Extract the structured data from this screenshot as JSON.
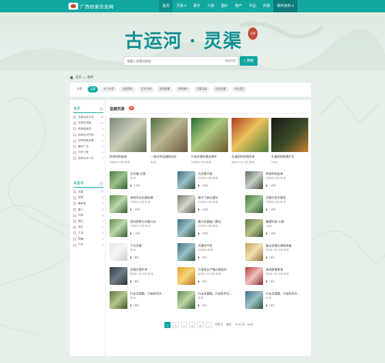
{
  "brand": {
    "logo_text": "广西档案信息网"
  },
  "nav": [
    {
      "label": "首页"
    },
    {
      "label": "灵渠 ▾"
    },
    {
      "label": "事件"
    },
    {
      "label": "人物"
    },
    {
      "label": "图片"
    },
    {
      "label": "物产"
    },
    {
      "label": "作品"
    },
    {
      "label": "风貌"
    },
    {
      "label": "视听资料 ▾"
    }
  ],
  "hero": {
    "title": "古运河 · 灵渠",
    "seal": "灵渠"
  },
  "search": {
    "placeholder": "请输入关键词搜索",
    "advanced": "高级检索",
    "button": "搜索"
  },
  "breadcrumb": {
    "home": "首页",
    "sep": ">",
    "current": "视听"
  },
  "filters": [
    {
      "label": "分类",
      "style": "plain"
    },
    {
      "label": "全部",
      "style": "active"
    },
    {
      "label": "名人名家",
      "style": ""
    },
    {
      "label": "古建遗存",
      "style": ""
    },
    {
      "label": "文学书画",
      "style": ""
    },
    {
      "label": "民间故事",
      "style": ""
    },
    {
      "label": "特色物产",
      "style": ""
    },
    {
      "label": "灵渠风貌",
      "style": ""
    },
    {
      "label": "民俗风情",
      "style": ""
    },
    {
      "label": "兴安县区",
      "style": ""
    }
  ],
  "sidebar": {
    "group1": {
      "title": "来源",
      "items": [
        {
          "label": "灵渠历史文化",
          "count": "15"
        },
        {
          "label": "灵渠史话篇",
          "count": "10"
        },
        {
          "label": "桂林档案馆",
          "count": "5"
        },
        {
          "label": "桂林山水传说",
          "count": "4"
        },
        {
          "label": "桂林档案文献",
          "count": "2"
        },
        {
          "label": "廉州广西",
          "count": "2"
        },
        {
          "label": "百年八桂",
          "count": "1"
        },
        {
          "label": "桂林山水人文",
          "count": "1"
        }
      ]
    },
    "group2": {
      "title": "关键词",
      "items": [
        {
          "label": "灵渠",
          "count": "22"
        },
        {
          "label": "桂林",
          "count": "6"
        },
        {
          "label": "秦始皇",
          "count": "6"
        },
        {
          "label": "陡门",
          "count": "6"
        },
        {
          "label": "兴安",
          "count": "5"
        },
        {
          "label": "湘江",
          "count": "5"
        },
        {
          "label": "漓江",
          "count": "4"
        },
        {
          "label": "大湾",
          "count": "4"
        },
        {
          "label": "铧嘴",
          "count": "3"
        },
        {
          "label": "严关",
          "count": "3"
        }
      ]
    }
  },
  "list": {
    "title": "音频列表",
    "count": "16"
  },
  "big_cards": [
    {
      "title": "四贤祠的由来",
      "sub": "华夏航标·灵渠·第5集",
      "tone": "g1"
    },
    {
      "title": "一座古桥连通的历史",
      "sub": "第1集",
      "tone": "g2"
    },
    {
      "title": "兴安灵渠申遗五周年",
      "sub": "华夏航标·灵渠·第2集",
      "tone": "g3"
    },
    {
      "title": "孔雀园的秀丽风采",
      "sub": "梁跃进·兴安·灵渠·第4集",
      "tone": "g4"
    },
    {
      "title": "孔雀园的夜景灯光",
      "sub": "华夏灵",
      "tone": "g5"
    }
  ],
  "cards": [
    {
      "title": "分水塘·七跳",
      "sub": "第2集",
      "meta": "20播放",
      "tone": "g6"
    },
    {
      "title": "古灵渠河道",
      "sub": "华夏航标·灵渠·第9集",
      "meta": "20播放",
      "tone": "g7"
    },
    {
      "title": "四贤祠的由来",
      "sub": "华夏航标·灵渠·第3集",
      "meta": "16播放",
      "tone": "g8"
    },
    {
      "title": "李明华在灵渠修建",
      "sub": "华夏航标·灵渠·第1集",
      "meta": "15播放",
      "tone": "g9"
    },
    {
      "title": "秦代飞来石遗址",
      "sub": "华夏航标·灵渠·第4集",
      "meta": "14播放",
      "tone": "g10"
    },
    {
      "title": "灵渠大型灵渠泉",
      "sub": "华夏航标·灵渠·第7集",
      "meta": "13播放",
      "tone": "g6"
    },
    {
      "title": "西村桥畔与灵渠分水",
      "sub": "华夏航标·灵渠·第3集",
      "meta": "12播放",
      "tone": "g9"
    },
    {
      "title": "秦开灵渠陡门遗址",
      "sub": "华夏航标·灵渠·第6集",
      "meta": "11播放",
      "tone": "g7"
    },
    {
      "title": "秦堤四贤·七跳",
      "sub": "大秦岭",
      "meta": "10播放",
      "tone": "g16"
    },
    {
      "title": "千古灵渠",
      "sub": "第1集",
      "meta": "9播放",
      "tone": "g11"
    },
    {
      "title": "灵渠的今世",
      "sub": "华夏航标·第5集",
      "meta": "9播放",
      "tone": "g7"
    },
    {
      "title": "陡元灵渠古建筑修复",
      "sub": "梁跃进·兴安·灵渠·第2集",
      "meta": "8播放",
      "tone": "g12"
    },
    {
      "title": "灵渠大营严关",
      "sub": "梁跃进·兴安·灵渠·第1集",
      "meta": "8播放",
      "tone": "g13"
    },
    {
      "title": "万里桥头严镇与黄旭华",
      "sub": "梁跃进·兴安·灵渠·第3集",
      "meta": "7播放",
      "tone": "g14"
    },
    {
      "title": "海滨泉雾景观",
      "sub": "梁跃进·兴安·灵渠·第4集",
      "meta": "7播放",
      "tone": "g15"
    },
    {
      "title": "行走灵渠篇，兴安彩色天…",
      "sub": "第2集",
      "meta": "6播放",
      "tone": "g16"
    },
    {
      "title": "行走灵渠篇，兴安彩色天…",
      "sub": "第3集",
      "meta": "6播放",
      "tone": "g9"
    },
    {
      "title": "行走灵渠篇，兴安彩色天…",
      "sub": "第1集",
      "meta": "5播放",
      "tone": "g7"
    }
  ],
  "pager": {
    "pages": [
      "1",
      "2",
      "3",
      "4",
      "5",
      "»"
    ],
    "jump_label": "到第页",
    "go": "确定",
    "total": "共 84 条，66/页"
  }
}
